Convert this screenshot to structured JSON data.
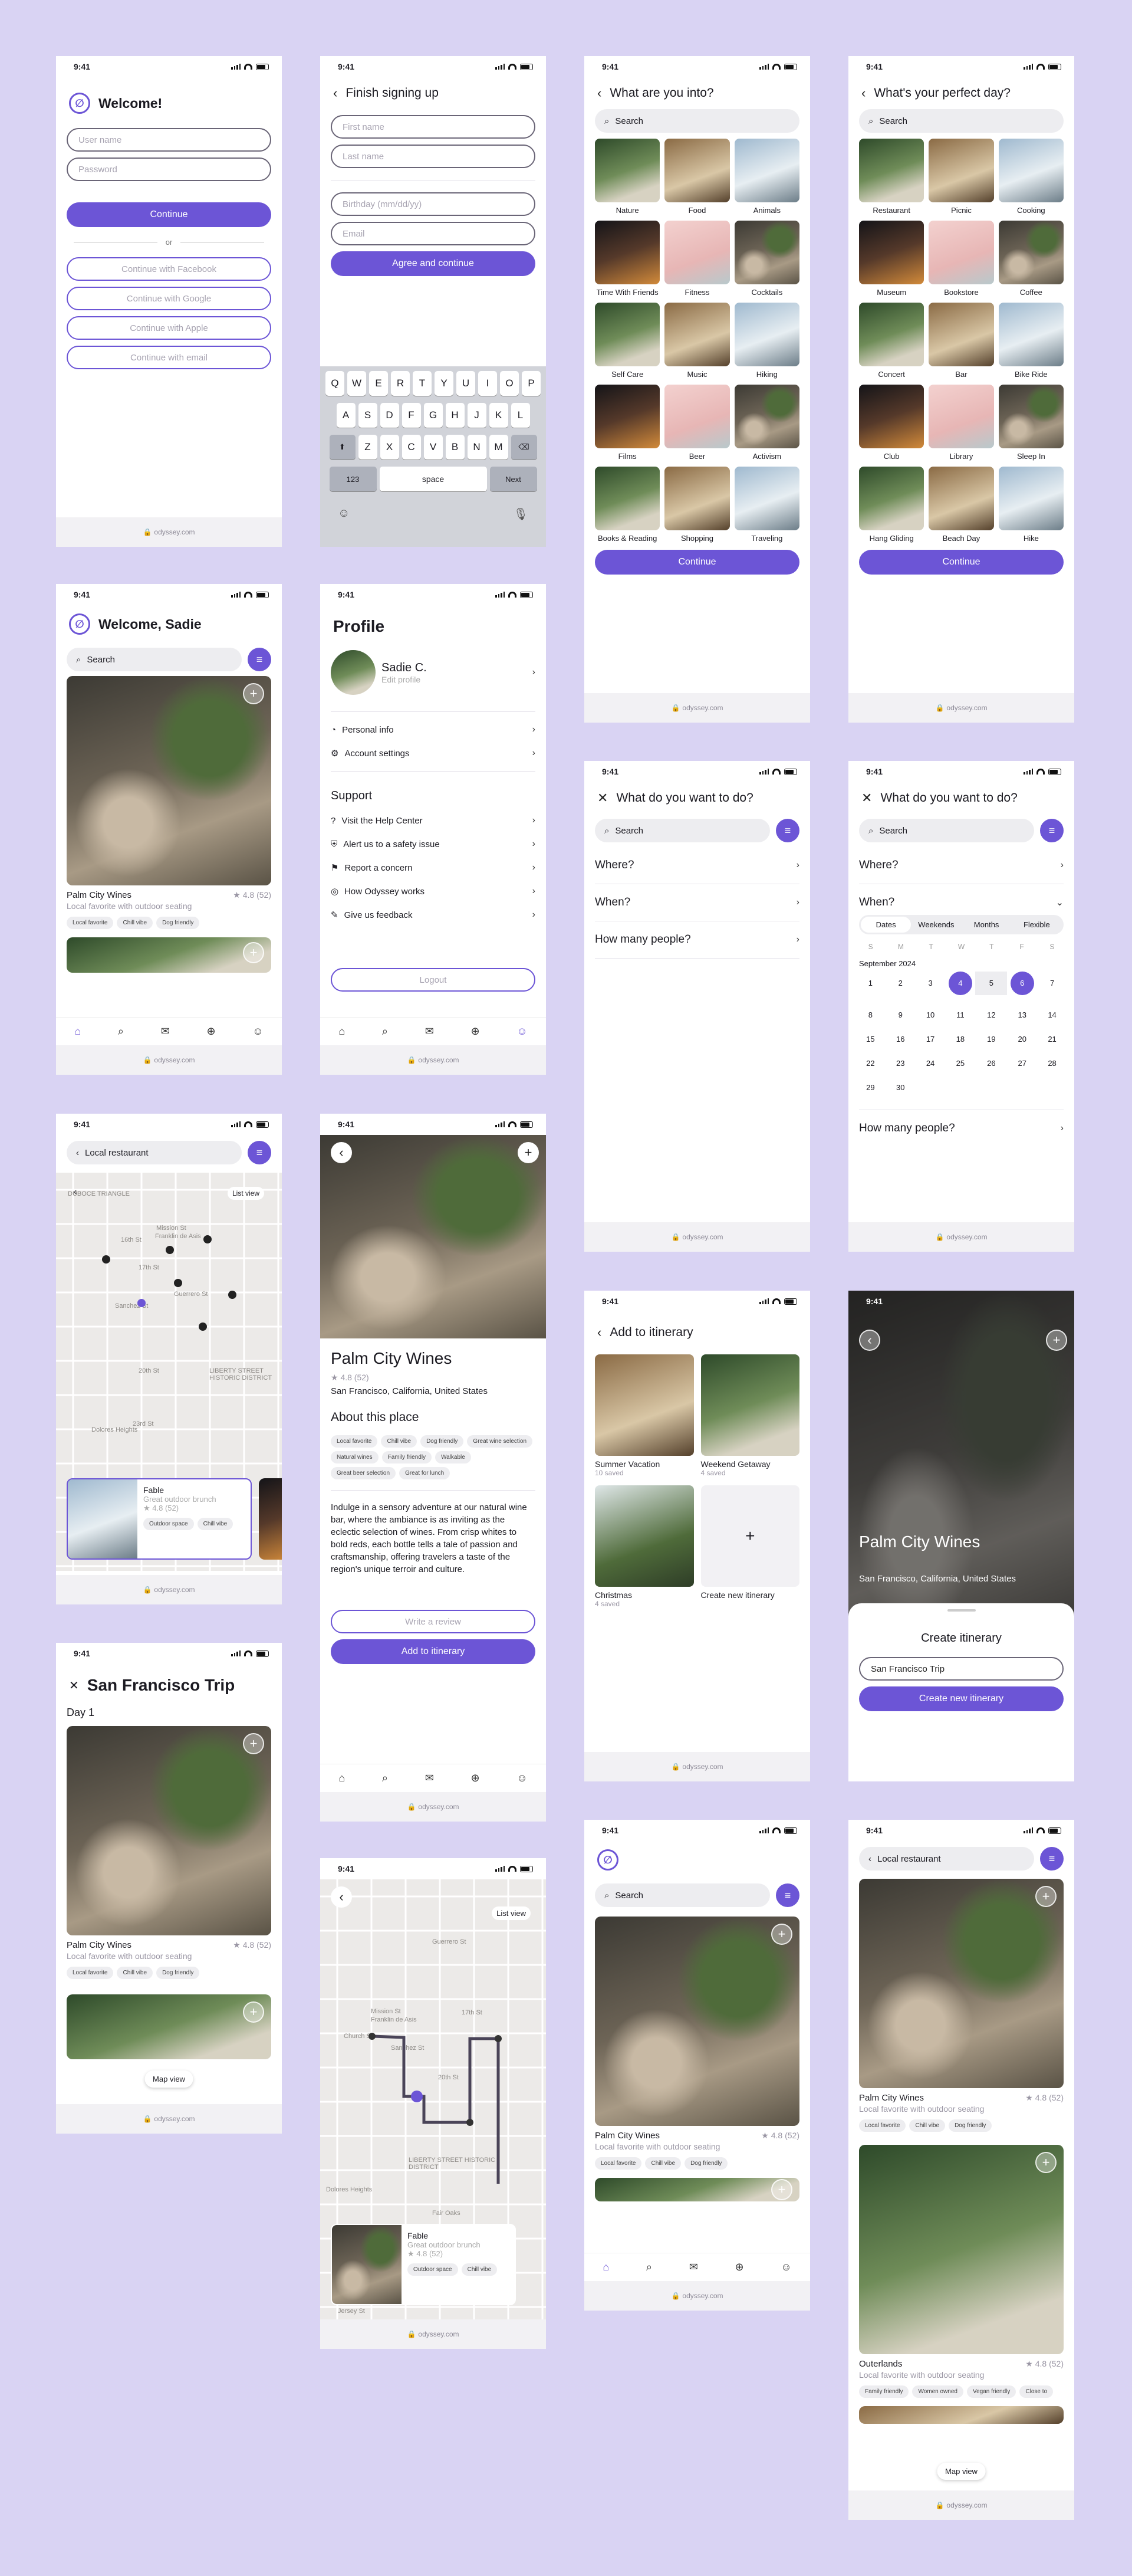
{
  "status_time": "9:41",
  "url": "odyssey.com",
  "login": {
    "title": "Welcome!",
    "username_placeholder": "User name",
    "password_placeholder": "Password",
    "continue": "Continue",
    "or": "or",
    "facebook": "Continue with Facebook",
    "google": "Continue with Google",
    "apple": "Continue with Apple",
    "email": "Continue with email"
  },
  "signup": {
    "title": "Finish signing up",
    "first_name": "First name",
    "last_name": "Last name",
    "birthday": "Birthday (mm/dd/yy)",
    "email": "Email",
    "agree": "Agree and continue",
    "keyboard": {
      "row1": [
        "Q",
        "W",
        "E",
        "R",
        "T",
        "Y",
        "U",
        "I",
        "O",
        "P"
      ],
      "row2": [
        "A",
        "S",
        "D",
        "F",
        "G",
        "H",
        "J",
        "K",
        "L"
      ],
      "row3": [
        "Z",
        "X",
        "C",
        "V",
        "B",
        "N",
        "M"
      ],
      "num": "123",
      "space": "space",
      "next": "Next"
    }
  },
  "interests": {
    "title": "What are you into?",
    "search": "Search",
    "items": [
      "Nature",
      "Food",
      "Animals",
      "Time With Friends",
      "Fitness",
      "Cocktails",
      "Self Care",
      "Music",
      "Hiking",
      "Films",
      "Beer",
      "Activism",
      "Books & Reading",
      "Shopping",
      "Traveling"
    ],
    "continue": "Continue"
  },
  "perfect_day": {
    "title": "What's your perfect day?",
    "search": "Search",
    "items": [
      "Restaurant",
      "Picnic",
      "Cooking",
      "Museum",
      "Bookstore",
      "Coffee",
      "Concert",
      "Bar",
      "Bike Ride",
      "Club",
      "Library",
      "Sleep In",
      "Hang Gliding",
      "Beach Day",
      "Hike"
    ],
    "continue": "Continue"
  },
  "home": {
    "title": "Welcome, Sadie",
    "search": "Search",
    "place_name": "Palm City Wines",
    "rating": "★ 4.8 (52)",
    "subtitle": "Local favorite with outdoor seating",
    "chips": [
      "Local favorite",
      "Chill vibe",
      "Dog friendly"
    ]
  },
  "profile": {
    "title": "Profile",
    "name": "Sadie C.",
    "edit": "Edit profile",
    "items": [
      "Personal info",
      "Account settings"
    ],
    "support_title": "Support",
    "support_items": [
      "Visit the Help Center",
      "Alert us to a safety issue",
      "Report a concern",
      "How Odyssey works",
      "Give us feedback"
    ],
    "logout": "Logout"
  },
  "what_to_do": {
    "title": "What do you want to do?",
    "search": "Search",
    "where": "Where?",
    "when": "When?",
    "people": "How many people?"
  },
  "calendar": {
    "tabs": [
      "Dates",
      "Weekends",
      "Months",
      "Flexible"
    ],
    "weekdays": [
      "S",
      "M",
      "T",
      "W",
      "T",
      "F",
      "S"
    ],
    "month": "September 2024",
    "days": [
      "1",
      "2",
      "3",
      "4",
      "5",
      "6",
      "7",
      "8",
      "9",
      "10",
      "11",
      "12",
      "13",
      "14",
      "15",
      "16",
      "17",
      "18",
      "19",
      "20",
      "21",
      "22",
      "23",
      "24",
      "25",
      "26",
      "27",
      "28",
      "29",
      "30"
    ],
    "selected_start": "4",
    "selected_end": "6"
  },
  "map_search": {
    "query": "Local restaurant",
    "list_view": "List view",
    "labels": [
      "DUBOCE TRIANGLE",
      "16th St",
      "Mission St",
      "Franklin de Asis",
      "17th St",
      "Sanchez St",
      "Guerrero St",
      "20th St",
      "23rd St",
      "LIBERTY STREET HISTORIC DISTRICT",
      "Dolores Heights"
    ],
    "card_name": "Fable",
    "card_sub": "Great outdoor brunch",
    "card_rating": "★ 4.8 (52)",
    "card_chips": [
      "Outdoor space",
      "Chill vibe"
    ]
  },
  "detail": {
    "name": "Palm City Wines",
    "rating": "★ 4.8 (52)",
    "location": "San Francisco, California, United States",
    "about_title": "About this place",
    "chips": [
      "Local favorite",
      "Chill vibe",
      "Dog friendly",
      "Great wine selection",
      "Natural wines",
      "Family friendly",
      "Walkable",
      "Great beer selection",
      "Great for lunch"
    ],
    "description": "Indulge in a sensory adventure at our natural wine bar, where the ambiance is as inviting as the eclectic selection of wines. From crisp whites to bold reds, each bottle tells a tale of passion and craftsmanship, offering travelers a taste of the region's unique terroir and culture.",
    "review": "Write a review",
    "add": "Add to itinerary"
  },
  "add_itinerary": {
    "title": "Add to itinerary",
    "items": [
      {
        "name": "Summer Vacation",
        "sub": "10 saved"
      },
      {
        "name": "Weekend Getaway",
        "sub": "4 saved"
      },
      {
        "name": "Christmas",
        "sub": "4 saved"
      }
    ],
    "new": "Create new itinerary"
  },
  "create_itinerary": {
    "name": "Palm City Wines",
    "location": "San Francisco, California, United States",
    "title": "Create itinerary",
    "input": "San Francisco Trip",
    "button": "Create new itinerary"
  },
  "trip": {
    "title": "San Francisco Trip",
    "day": "Day 1",
    "map_view": "Map view"
  },
  "route_map": {
    "list_view": "List view",
    "labels": [
      "Guerrero St",
      "Mission St",
      "Franklin de Asis",
      "17th St",
      "Church St",
      "Sanchez St",
      "20th St",
      "LIBERTY STREET HISTORIC DISTRICT",
      "Fair Oaks",
      "Dolores Heights",
      "Jersey St"
    ],
    "card_name": "Fable",
    "card_sub": "Great outdoor brunch",
    "card_rating": "★ 4.8 (52)",
    "card_chips": [
      "Outdoor space",
      "Chill vibe"
    ]
  },
  "feed2": {
    "search": "Search"
  },
  "results": {
    "query": "Local restaurant",
    "second_name": "Outerlands",
    "second_rating": "★ 4.8 (52)",
    "second_sub": "Local favorite with outdoor seating",
    "second_chips": [
      "Family friendly",
      "Women owned",
      "Vegan friendly",
      "Close to"
    ],
    "map_view": "Map view"
  },
  "colors": {
    "accent": "#6c55d6",
    "background": "#d9d3f3"
  }
}
